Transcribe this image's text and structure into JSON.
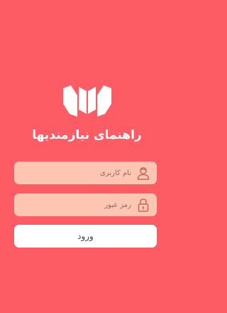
{
  "app": {
    "title": "راهنمای نیازمندیها",
    "logo": "open-book-logo",
    "background_color": "#fd5c64"
  },
  "form": {
    "username": {
      "placeholder": "نام کاربری",
      "value": "",
      "icon": "user-icon"
    },
    "password": {
      "placeholder": "رمز عبور",
      "value": "",
      "icon": "lock-icon"
    },
    "login_label": "ورود"
  },
  "colors": {
    "field_bg": "#fec5b3",
    "button_bg": "#ffffff",
    "icon": "#c06a62"
  }
}
